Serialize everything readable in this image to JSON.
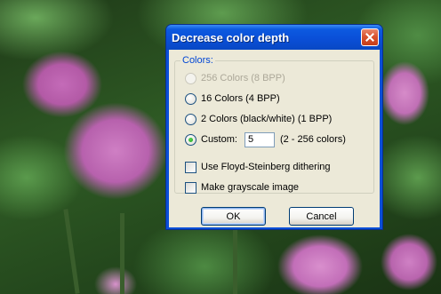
{
  "dialog": {
    "title": "Decrease color depth",
    "group_label": "Colors:",
    "options": [
      {
        "label": "256 Colors (8 BPP)",
        "enabled": false,
        "selected": false
      },
      {
        "label": "16 Colors (4 BPP)",
        "enabled": true,
        "selected": false
      },
      {
        "label": "2 Colors (black/white) (1 BPP)",
        "enabled": true,
        "selected": false
      },
      {
        "label": "Custom:",
        "enabled": true,
        "selected": true
      }
    ],
    "custom_value": "5",
    "custom_range": "(2 - 256 colors)",
    "checkboxes": [
      {
        "label": "Use Floyd-Steinberg dithering",
        "checked": false
      },
      {
        "label": "Make grayscale image",
        "checked": false
      }
    ],
    "ok_label": "OK",
    "cancel_label": "Cancel"
  },
  "colors": {
    "titlebar": "#0a4fd8",
    "client_bg": "#ece9d8",
    "group_label": "#0046d5",
    "close_button": "#d9532f"
  },
  "icons": {
    "close": "close-icon"
  }
}
